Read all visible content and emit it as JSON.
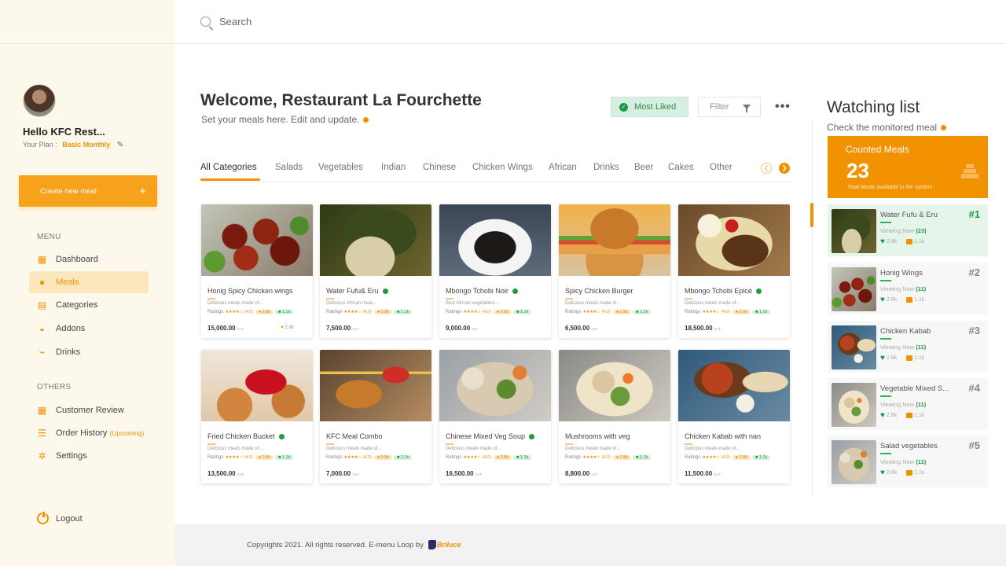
{
  "search": {
    "placeholder": "Search"
  },
  "user": {
    "name": "Hello KFC Rest...",
    "plan_label": "Your Plan :",
    "plan_name": "Basic Monthly"
  },
  "create_button": {
    "label": "Create new meal",
    "icon": "plus-icon"
  },
  "menu": {
    "title": "MENU",
    "items": [
      {
        "label": "Dashboard",
        "icon": "dashboard-icon",
        "active": false
      },
      {
        "label": "Meals",
        "icon": "meals-icon",
        "active": true
      },
      {
        "label": "Categories",
        "icon": "categories-icon",
        "active": false
      },
      {
        "label": "Addons",
        "icon": "addons-icon",
        "active": false
      },
      {
        "label": "Drinks",
        "icon": "drinks-icon",
        "active": false
      }
    ]
  },
  "others": {
    "title": "OTHERS",
    "items": [
      {
        "label": "Customer Review",
        "icon": "review-icon"
      },
      {
        "label": "Order History",
        "icon": "order-history-icon",
        "badge": "(Upcoming)"
      },
      {
        "label": "Settings",
        "icon": "settings-icon"
      }
    ]
  },
  "logout": {
    "label": "Logout"
  },
  "header": {
    "title": "Welcome, Restaurant La Fourchette",
    "subtitle": "Set your meals here. Edit and update.",
    "most_liked": "Most Liked",
    "filter": "Filter"
  },
  "categories": [
    "All Categories",
    "Salads",
    "Vegetables",
    "Indian",
    "Chinese",
    "Chicken Wings",
    "African",
    "Drinks",
    "Beer",
    "Cakes",
    "Other"
  ],
  "meals": [
    {
      "name": "Honig Spicy Chicken wings",
      "verified": false,
      "desc": "Delicious meals made of...",
      "rating": "(4.0)",
      "views": "2.8k",
      "likes_g": "1.1k",
      "price": "15,000.00",
      "currency": "XAF",
      "hearts": "2.8k"
    },
    {
      "name": "Water Fufu& Eru",
      "verified": true,
      "desc": "Delicious African meal...",
      "rating": "(4.0)",
      "views": "2.8k",
      "likes_g": "1.1k",
      "price": "7,500.00",
      "currency": "XAF"
    },
    {
      "name": "Mbongo Tchobi Noir",
      "verified": true,
      "desc": "Best African vegetables...",
      "rating": "(4.0)",
      "views": "2.8k",
      "likes_g": "1.1k",
      "price": "9,000.00",
      "currency": "XAF"
    },
    {
      "name": "Spicy Chicken Burger",
      "verified": false,
      "desc": "Delicious meals made of...",
      "rating": "(4.0)",
      "views": "2.8k",
      "likes_g": "1.1k",
      "price": "6,500.00",
      "currency": "XAF"
    },
    {
      "name": "Mbongo Tchobi Epicé",
      "verified": true,
      "desc": "Delicious meals made of...",
      "rating": "(4.0)",
      "views": "2.8k",
      "likes_g": "1.1k",
      "price": "18,500.00",
      "currency": "XAF"
    },
    {
      "name": "Fried Chicken Bucket",
      "verified": true,
      "desc": "Delicious meals made of...",
      "rating": "(4.0)",
      "views": "2.8k",
      "likes_g": "1.1k",
      "price": "13,500.00",
      "currency": "XAF"
    },
    {
      "name": "KFC Meal Combo",
      "verified": false,
      "desc": "Delicious meals made of...",
      "rating": "(4.0)",
      "views": "2.8k",
      "likes_g": "1.1k",
      "price": "7,000.00",
      "currency": "XAF"
    },
    {
      "name": "Chinese Mixed Veg Soup",
      "verified": true,
      "desc": "Delicious meals made of...",
      "rating": "(4.0)",
      "views": "2.8k",
      "likes_g": "1.1k",
      "price": "16,500.00",
      "currency": "XAF"
    },
    {
      "name": "Mushrooms with veg",
      "verified": false,
      "desc": "Delicious meals made of...",
      "rating": "(4.0)",
      "views": "2.8k",
      "likes_g": "1.1k",
      "price": "8,800.00",
      "currency": "XAF"
    },
    {
      "name": "Chicken Kabab with nan",
      "verified": false,
      "desc": "Delicious meals made of...",
      "rating": "(4.0)",
      "views": "2.8k",
      "likes_g": "1.1k",
      "price": "11,500.00",
      "currency": "XAF"
    }
  ],
  "ratings_label": "Ratings",
  "watching": {
    "title": "Watching list",
    "subtitle": "Check the monitored meal",
    "counted_label": "Counted Meals",
    "counted_value": "23",
    "counted_caption": "Total Meals available in the system",
    "viewing_label": "Viewing Now",
    "items": [
      {
        "name": "Water Fufu & Eru",
        "viewing": "(23)",
        "hearts": "2.8k",
        "comments": "1.1k",
        "rank": "#1"
      },
      {
        "name": "Honig Wings",
        "viewing": "(11)",
        "hearts": "2.8k",
        "comments": "1.1k",
        "rank": "#2"
      },
      {
        "name": "Chicken Kabab",
        "viewing": "(11)",
        "hearts": "2.8k",
        "comments": "1.1k",
        "rank": "#3"
      },
      {
        "name": "Vegetable Mixed S...",
        "viewing": "(11)",
        "hearts": "2.8k",
        "comments": "1.1k",
        "rank": "#4"
      },
      {
        "name": "Salad vegetables",
        "viewing": "(11)",
        "hearts": "2.8k",
        "comments": "1.1k",
        "rank": "#5"
      }
    ]
  },
  "footer": {
    "text": "Copyrights 2021. All rights reserved. E-menu Loop by",
    "brand": "Briluce"
  },
  "colors": {
    "accent": "#f39200",
    "green": "#1d9a46",
    "sidebar_bg": "#fdf8ec"
  }
}
